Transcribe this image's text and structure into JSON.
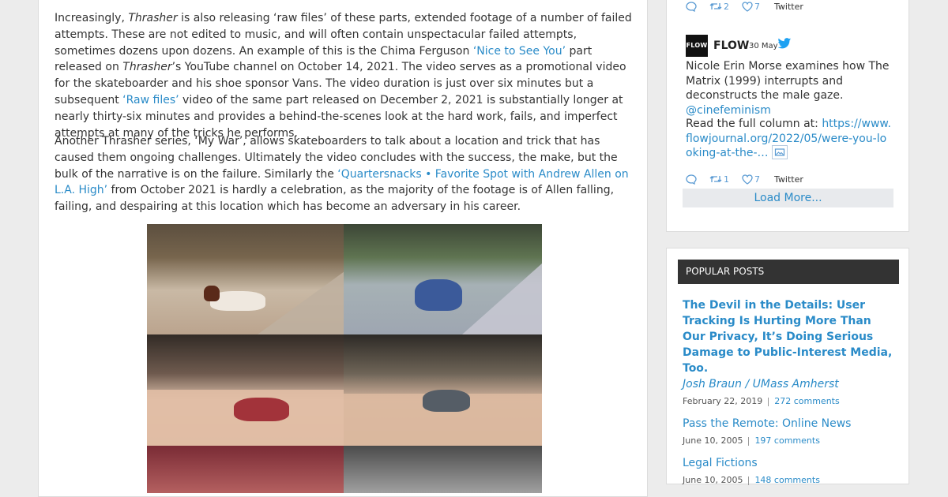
{
  "article": {
    "p1": {
      "t1": "Increasingly, ",
      "em1": "Thrasher",
      "t2": " is also releasing ‘raw files’ of these parts, extended footage of a number of failed attempts. These are not edited to music, and will often contain unspectacular failed attempts, sometimes dozens upon dozens. An example of this is the Chima Ferguson ",
      "link1": "‘Nice to See You’",
      "t3": " part released on ",
      "em2": "Thrasher",
      "t4": "’s YouTube channel on October 14, 2021. The video serves as a promotional video for the skateboarder and his shoe sponsor Vans. The video duration is just over six minutes but a subsequent ",
      "link2": "‘Raw files’",
      "t5": " video of the same part released on December 2, 2021 is substantially longer at nearly thirty-six minutes  and provides a behind-the-scenes look at the hard work, fails, and imperfect attempts at many of the tricks he performs."
    },
    "p2": {
      "t1": "Another Thrasher series, ‘My War’, allows skateboarders to talk about a location and trick that has caused them ongoing challenges. Ultimately the video concludes with the success, the make, but the bulk of the narrative is on the failure. Similarly the ",
      "link1": "‘Quartersnacks • Favorite Spot with Andrew Allen on L.A. High’",
      "t2": " from October 2021 is hardly a celebration, as the majority of the footage is of Allen falling, failing, and despairing at this location which has become an adversary in his career."
    }
  },
  "twitter": {
    "prev_tweet": {
      "retweets": "2",
      "likes": "7",
      "source": "Twitter"
    },
    "tweet": {
      "avatar_text": "FLOW",
      "name": "FLOW",
      "date": "30 May",
      "text1": "Nicole Erin Morse examines how The Matrix (1999) interrupts and deconstructs the male gaze. ",
      "mention": "@cinefeminism",
      "text2": "Read the full column at: ",
      "url": "https://www.flowjournal.org/2022/05/were-you-looking-at-the-…",
      "retweets": "1",
      "likes": "7",
      "source": "Twitter"
    },
    "load_more": "Load More..."
  },
  "popular_posts": {
    "heading": "POPULAR POSTS",
    "items": [
      {
        "title": "The Devil in the Details: User Tracking Is Hurting More Than Our Privacy, It’s Doing Serious Damage to Public-Interest Media, Too.",
        "author": "Josh Braun / UMass Amherst",
        "date": "February 22, 2019",
        "comments": "272 comments"
      },
      {
        "title": "Pass the Remote: Online News",
        "date": "June 10, 2005",
        "comments": "197 comments"
      },
      {
        "title": "Legal Fictions",
        "date": "June 10, 2005",
        "comments": "148 comments"
      }
    ]
  },
  "colors": {
    "link": "#2a8bc8",
    "heading_bg": "#333333",
    "page_bg": "#ececec",
    "twitter_blue": "#1da1f2"
  },
  "icons": [
    "reply-icon",
    "retweet-icon",
    "heart-icon",
    "twitter-bird-icon",
    "image-icon"
  ]
}
